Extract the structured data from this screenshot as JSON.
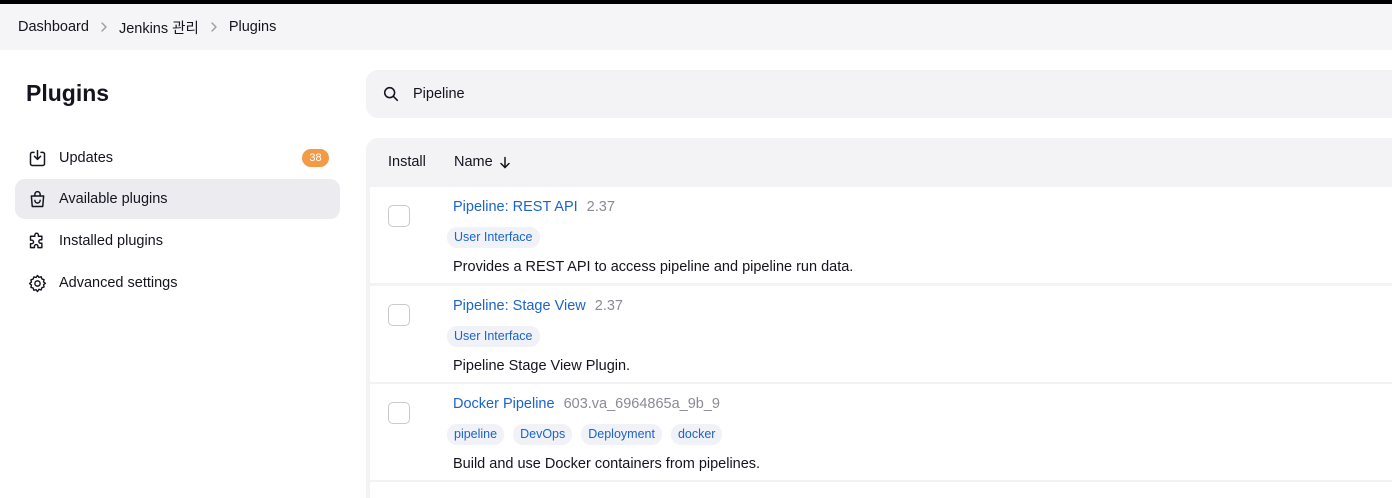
{
  "breadcrumb": {
    "items": [
      "Dashboard",
      "Jenkins 관리",
      "Plugins"
    ]
  },
  "sidebar": {
    "title": "Plugins",
    "items": [
      {
        "label": "Updates",
        "icon": "download-icon",
        "badge": "38",
        "active": false
      },
      {
        "label": "Available plugins",
        "icon": "shopping-bag-icon",
        "active": true
      },
      {
        "label": "Installed plugins",
        "icon": "puzzle-icon",
        "active": false
      },
      {
        "label": "Advanced settings",
        "icon": "gear-icon",
        "active": false
      }
    ]
  },
  "search": {
    "value": "Pipeline",
    "icon": "search-icon"
  },
  "table": {
    "headers": {
      "install": "Install",
      "name": "Name",
      "sort_icon": "arrow-down-icon"
    },
    "rows": [
      {
        "name": "Pipeline: REST API",
        "version": "2.37",
        "tags": [
          "User Interface"
        ],
        "description": "Provides a REST API to access pipeline and pipeline run data."
      },
      {
        "name": "Pipeline: Stage View",
        "version": "2.37",
        "tags": [
          "User Interface"
        ],
        "description": "Pipeline Stage View Plugin."
      },
      {
        "name": "Docker Pipeline",
        "version": "603.va_6964865a_9b_9",
        "tags": [
          "pipeline",
          "DevOps",
          "Deployment",
          "docker"
        ],
        "description": "Build and use Docker containers from pipelines."
      }
    ]
  },
  "colors": {
    "accent_link": "#1b64c8",
    "badge": "#f29a46",
    "active_item_bg": "#ececf0",
    "panel_bg": "#f3f3f6"
  }
}
